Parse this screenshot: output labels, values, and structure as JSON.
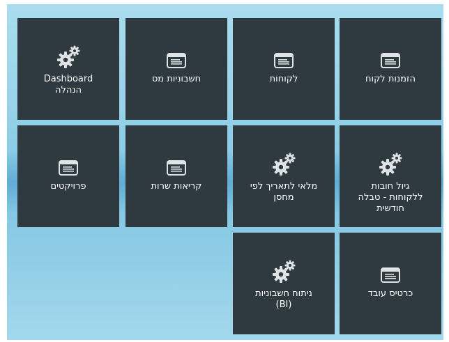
{
  "tiles": [
    {
      "label": "הזמנות לקוח",
      "icon": "window-icon"
    },
    {
      "label": "לקוחות",
      "icon": "window-icon"
    },
    {
      "label": "חשבוניות מס",
      "icon": "window-icon"
    },
    {
      "label": "Dashboard\nהנהלה",
      "icon": "gear-icon"
    },
    {
      "label": "גיול חובות\nללקוחות - טבלה\nחודשית",
      "icon": "gear-icon"
    },
    {
      "label": "מלאי לתאריך לפי\nמחסן",
      "icon": "gear-icon"
    },
    {
      "label": "קריאות שרות",
      "icon": "window-icon"
    },
    {
      "label": "פרויקטים",
      "icon": "window-icon"
    },
    {
      "label": "כרטיס עובד",
      "icon": "window-icon"
    },
    {
      "label": "ניתוח חשבוניות\n(BI)",
      "icon": "gear-icon"
    }
  ],
  "colors": {
    "tile_bg": "#2f3a40",
    "tile_text": "#ffffff",
    "icon": "#dfe3e5",
    "background": "#98d3ea"
  }
}
